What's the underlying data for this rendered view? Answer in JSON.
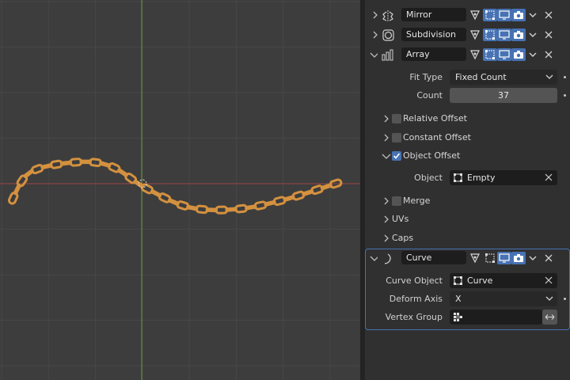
{
  "modifiers": [
    {
      "name": "Mirror",
      "icon": "mirror-modifier-icon",
      "expanded": false
    },
    {
      "name": "Subdivision",
      "icon": "subdivision-modifier-icon",
      "expanded": false
    },
    {
      "name": "Array",
      "icon": "array-modifier-icon",
      "expanded": true
    },
    {
      "name": "Curve",
      "icon": "curve-modifier-icon",
      "expanded": true
    }
  ],
  "array": {
    "fit_type_label": "Fit Type",
    "fit_type_value": "Fixed Count",
    "count_label": "Count",
    "count_value": "37",
    "relative_offset": {
      "label": "Relative Offset",
      "checked": false
    },
    "constant_offset": {
      "label": "Constant Offset",
      "checked": false
    },
    "object_offset": {
      "label": "Object Offset",
      "checked": true
    },
    "object_label": "Object",
    "object_value": "Empty",
    "merge": {
      "label": "Merge",
      "checked": false
    },
    "uvs_label": "UVs",
    "caps_label": "Caps"
  },
  "curve": {
    "curve_object_label": "Curve Object",
    "curve_object_value": "Curve",
    "deform_axis_label": "Deform Axis",
    "deform_axis_value": "X",
    "vertex_group_label": "Vertex Group",
    "vertex_group_value": ""
  },
  "colors": {
    "accent": "#4772b3",
    "chain": "#d4913f",
    "x_axis": "#a04848",
    "y_axis": "#6a9a3a",
    "grid": "#474747",
    "viewport_bg": "#3d3d3d",
    "panel_bg": "#303030"
  }
}
